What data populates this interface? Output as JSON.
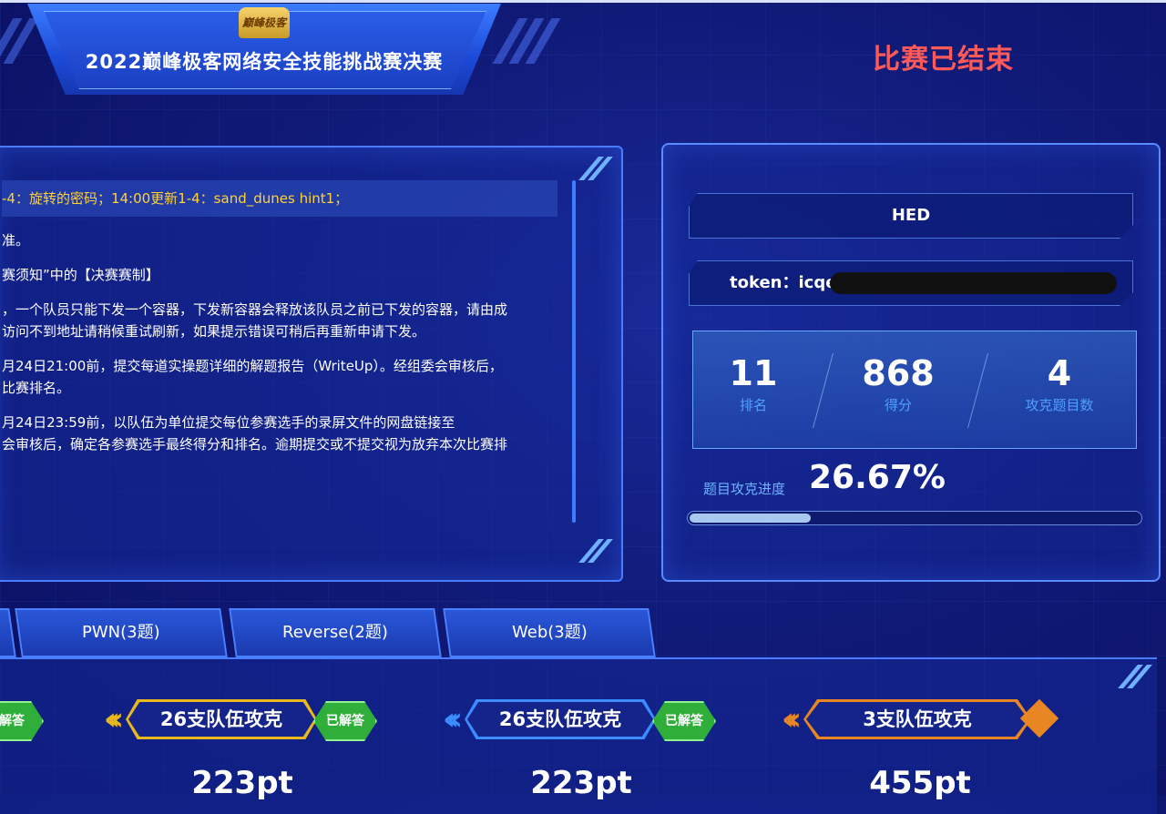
{
  "header": {
    "title": "2022巅峰极客网络安全技能挑战赛决赛",
    "logo_text": "巅峰极客",
    "status": "比赛已结束"
  },
  "notice": {
    "headline": "-4：旋转的密码；14:00更新1-4：sand_dunes hint1；",
    "paragraphs": [
      "准。",
      "赛须知”中的【决赛赛制】",
      "，一个队员只能下发一个容器，下发新容器会释放该队员之前已下发的容器，请由成\n访问不到地址请稍候重试刷新，如果提示错误可稍后再重新申请下发。",
      "月24日21:00前，提交每道实操题详细的解题报告（WriteUp）。经组委会审核后，\n比赛排名。",
      "月24日23:59前，以队伍为单位提交每位参赛选手的录屏文件的网盘链接至\n会审核后，确定各参赛选手最终得分和排名。逾期提交或不提交视为放弃本次比赛排"
    ]
  },
  "team": {
    "name": "HED",
    "token_label": "token：icqe",
    "rank": "11",
    "rank_label": "排名",
    "score": "868",
    "score_label": "得分",
    "solved": "4",
    "solved_label": "攻克题目数",
    "progress_label": "题目攻克进度",
    "progress_value": "26.67%",
    "progress_fraction": 0.2667
  },
  "tabs": [
    {
      "label": "PWN(3题)"
    },
    {
      "label": "Reverse(2题)"
    },
    {
      "label": "Web(3题)"
    }
  ],
  "challenges": [
    {
      "solved_label": "解答"
    },
    {
      "teams_text": "26支队伍攻克",
      "solved_label": "已解答",
      "score": "223pt",
      "color": "#e8b81c"
    },
    {
      "teams_text": "26支队伍攻克",
      "solved_label": "已解答",
      "score": "223pt",
      "color": "#3a8cff"
    },
    {
      "teams_text": "3支队伍攻克",
      "score": "455pt",
      "color": "#e88624"
    }
  ]
}
